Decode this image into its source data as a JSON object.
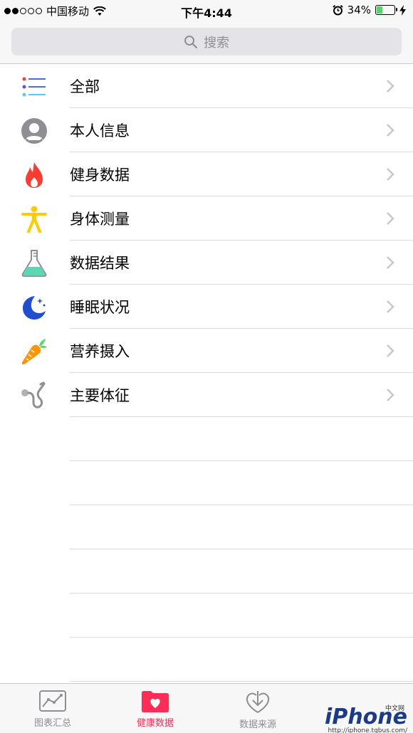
{
  "status_bar": {
    "signal_dots": [
      true,
      true,
      false,
      false,
      false
    ],
    "carrier": "中国移动",
    "time": "下午4:44",
    "battery_percent_text": "34%",
    "battery_level": 0.34,
    "icons": [
      "wifi-icon",
      "alarm-icon",
      "battery-icon",
      "charging-icon"
    ]
  },
  "search": {
    "placeholder": "搜索"
  },
  "categories": [
    {
      "label": "全部",
      "icon": "list-icon"
    },
    {
      "label": "本人信息",
      "icon": "person-icon"
    },
    {
      "label": "健身数据",
      "icon": "flame-icon"
    },
    {
      "label": "身体测量",
      "icon": "body-icon"
    },
    {
      "label": "数据结果",
      "icon": "flask-icon"
    },
    {
      "label": "睡眠状况",
      "icon": "moon-icon"
    },
    {
      "label": "营养摄入",
      "icon": "carrot-icon"
    },
    {
      "label": "主要体征",
      "icon": "stethoscope-icon"
    }
  ],
  "tabbar": {
    "tabs": [
      {
        "label": "图表汇总",
        "icon": "chart-icon",
        "active": false
      },
      {
        "label": "健康数据",
        "icon": "health-folder-icon",
        "active": true
      },
      {
        "label": "数据来源",
        "icon": "download-heart-icon",
        "active": false
      }
    ]
  },
  "watermark": {
    "brand": "iPhone",
    "badge": "中文网",
    "url": "http://iphone.tgbus.com/"
  },
  "colors": {
    "accent": "#ff2d55",
    "flame": "#ff3b30",
    "body": "#ffcc00",
    "flask": "#5ad8b6",
    "moon": "#1f4fd0",
    "carrot": "#ff9500",
    "battery": "#4cd964"
  }
}
